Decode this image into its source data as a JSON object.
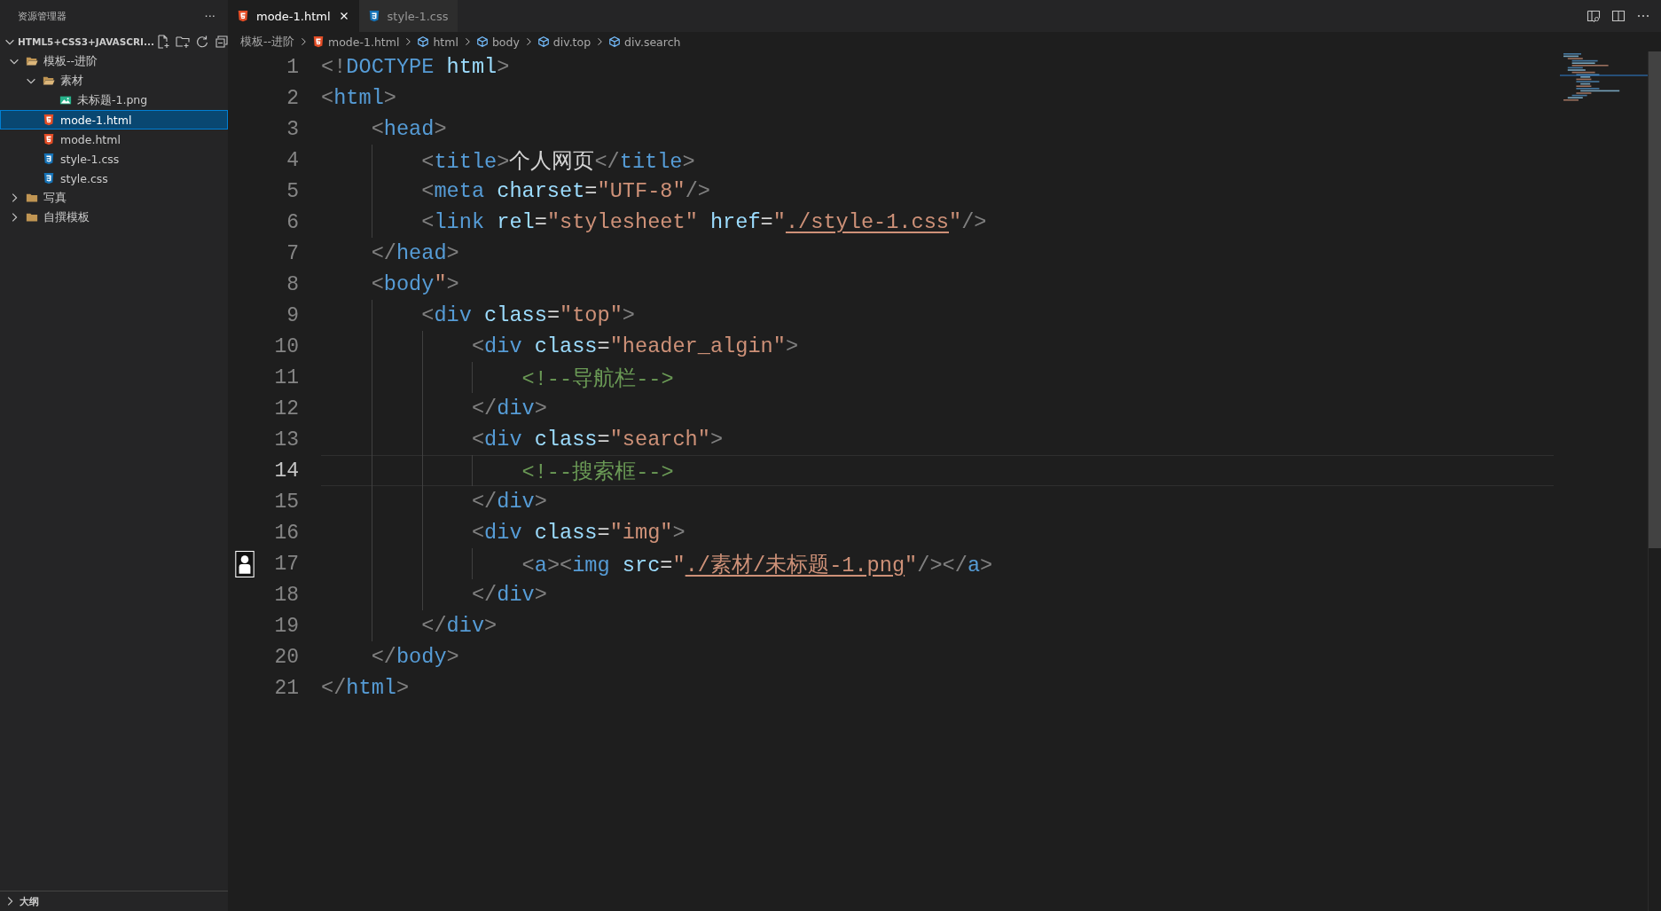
{
  "sidebar": {
    "title": "资源管理器",
    "more": "···",
    "workspace": {
      "name": "HTML5+CSS3+JAVASCRI...",
      "expanded": true
    },
    "tree": [
      {
        "label": "模板--进阶",
        "kind": "folder",
        "expanded": true,
        "selected": false,
        "children": [
          {
            "label": "素材",
            "kind": "folder",
            "expanded": true,
            "selected": false,
            "children": [
              {
                "label": "未标题-1.png",
                "kind": "image",
                "selected": false
              }
            ]
          },
          {
            "label": "mode-1.html",
            "kind": "html",
            "selected": true
          },
          {
            "label": "mode.html",
            "kind": "html",
            "selected": false
          },
          {
            "label": "style-1.css",
            "kind": "css",
            "selected": false
          },
          {
            "label": "style.css",
            "kind": "css",
            "selected": false
          }
        ]
      },
      {
        "label": "写真",
        "kind": "folder",
        "expanded": false,
        "selected": false
      },
      {
        "label": "自撰模板",
        "kind": "folder",
        "expanded": false,
        "selected": false
      }
    ],
    "outline": {
      "label": "大纲",
      "expanded": false
    }
  },
  "tabs": [
    {
      "label": "mode-1.html",
      "kind": "html",
      "selected": true
    },
    {
      "label": "style-1.css",
      "kind": "css",
      "selected": false
    }
  ],
  "breadcrumb": [
    {
      "label": "模板--进阶",
      "kind": "folder"
    },
    {
      "label": "mode-1.html",
      "kind": "html"
    },
    {
      "label": "html",
      "kind": "element"
    },
    {
      "label": "body",
      "kind": "element"
    },
    {
      "label": "div.top",
      "kind": "element"
    },
    {
      "label": "div.search",
      "kind": "element"
    }
  ],
  "editor": {
    "lines": [
      {
        "number": "1",
        "current": false,
        "gutter_icon": false,
        "tokens": [
          {
            "kind": "bracket",
            "text": "<!"
          },
          {
            "kind": "tag",
            "text": "DOCTYPE"
          },
          {
            "kind": "attr",
            "text": " html"
          },
          {
            "kind": "bracket",
            "text": ">"
          }
        ]
      },
      {
        "number": "2",
        "current": false,
        "gutter_icon": false,
        "tokens": [
          {
            "kind": "bracket",
            "text": "<"
          },
          {
            "kind": "tag",
            "text": "html"
          },
          {
            "kind": "bracket",
            "text": ">"
          }
        ]
      },
      {
        "number": "3",
        "current": false,
        "gutter_icon": false,
        "tokens": [
          {
            "kind": "bracket",
            "text": "    <"
          },
          {
            "kind": "tag",
            "text": "head"
          },
          {
            "kind": "bracket",
            "text": ">"
          }
        ]
      },
      {
        "number": "4",
        "current": false,
        "gutter_icon": false,
        "tokens": [
          {
            "kind": "bracket",
            "text": "        <"
          },
          {
            "kind": "tag",
            "text": "title"
          },
          {
            "kind": "bracket",
            "text": ">"
          },
          {
            "kind": "text",
            "text": "个人网页"
          },
          {
            "kind": "bracket",
            "text": "</"
          },
          {
            "kind": "tag",
            "text": "title"
          },
          {
            "kind": "bracket",
            "text": ">"
          }
        ]
      },
      {
        "number": "5",
        "current": false,
        "gutter_icon": false,
        "tokens": [
          {
            "kind": "bracket",
            "text": "        <"
          },
          {
            "kind": "tag",
            "text": "meta"
          },
          {
            "kind": "attr",
            "text": " charset"
          },
          {
            "kind": "text",
            "text": "="
          },
          {
            "kind": "string",
            "text": "\"UTF-8\""
          },
          {
            "kind": "bracket",
            "text": "/>"
          }
        ]
      },
      {
        "number": "6",
        "current": false,
        "gutter_icon": false,
        "tokens": [
          {
            "kind": "bracket",
            "text": "        <"
          },
          {
            "kind": "tag",
            "text": "link"
          },
          {
            "kind": "attr",
            "text": " rel"
          },
          {
            "kind": "text",
            "text": "="
          },
          {
            "kind": "string",
            "text": "\"stylesheet\""
          },
          {
            "kind": "attr",
            "text": " href"
          },
          {
            "kind": "text",
            "text": "="
          },
          {
            "kind": "string",
            "text": "\""
          },
          {
            "kind": "link",
            "text": "./style-1.css"
          },
          {
            "kind": "string",
            "text": "\""
          },
          {
            "kind": "bracket",
            "text": "/>"
          }
        ]
      },
      {
        "number": "7",
        "current": false,
        "gutter_icon": false,
        "tokens": [
          {
            "kind": "bracket",
            "text": "    </"
          },
          {
            "kind": "tag",
            "text": "head"
          },
          {
            "kind": "bracket",
            "text": ">"
          }
        ]
      },
      {
        "number": "8",
        "current": false,
        "gutter_icon": false,
        "tokens": [
          {
            "kind": "bracket",
            "text": "    <"
          },
          {
            "kind": "tag",
            "text": "body"
          },
          {
            "kind": "string",
            "text": "\""
          },
          {
            "kind": "bracket",
            "text": ">"
          }
        ]
      },
      {
        "number": "9",
        "current": false,
        "gutter_icon": false,
        "tokens": [
          {
            "kind": "bracket",
            "text": "        <"
          },
          {
            "kind": "tag",
            "text": "div"
          },
          {
            "kind": "attr",
            "text": " class"
          },
          {
            "kind": "text",
            "text": "="
          },
          {
            "kind": "string",
            "text": "\"top\""
          },
          {
            "kind": "bracket",
            "text": ">"
          }
        ]
      },
      {
        "number": "10",
        "current": false,
        "gutter_icon": false,
        "tokens": [
          {
            "kind": "bracket",
            "text": "            <"
          },
          {
            "kind": "tag",
            "text": "div"
          },
          {
            "kind": "attr",
            "text": " class"
          },
          {
            "kind": "text",
            "text": "="
          },
          {
            "kind": "string",
            "text": "\"header_algin\""
          },
          {
            "kind": "bracket",
            "text": ">"
          }
        ]
      },
      {
        "number": "11",
        "current": false,
        "gutter_icon": false,
        "tokens": [
          {
            "kind": "comment",
            "text": "                <!--导航栏-->"
          }
        ]
      },
      {
        "number": "12",
        "current": false,
        "gutter_icon": false,
        "tokens": [
          {
            "kind": "bracket",
            "text": "            </"
          },
          {
            "kind": "tag",
            "text": "div"
          },
          {
            "kind": "bracket",
            "text": ">"
          }
        ]
      },
      {
        "number": "13",
        "current": false,
        "gutter_icon": false,
        "tokens": [
          {
            "kind": "bracket",
            "text": "            <"
          },
          {
            "kind": "tag",
            "text": "div"
          },
          {
            "kind": "attr",
            "text": " class"
          },
          {
            "kind": "text",
            "text": "="
          },
          {
            "kind": "string",
            "text": "\"search\""
          },
          {
            "kind": "bracket",
            "text": ">"
          }
        ]
      },
      {
        "number": "14",
        "current": true,
        "gutter_icon": false,
        "tokens": [
          {
            "kind": "comment",
            "text": "                <!--搜索框-->"
          }
        ]
      },
      {
        "number": "15",
        "current": false,
        "gutter_icon": false,
        "tokens": [
          {
            "kind": "bracket",
            "text": "            </"
          },
          {
            "kind": "tag",
            "text": "div"
          },
          {
            "kind": "bracket",
            "text": ">"
          }
        ]
      },
      {
        "number": "16",
        "current": false,
        "gutter_icon": false,
        "tokens": [
          {
            "kind": "bracket",
            "text": "            <"
          },
          {
            "kind": "tag",
            "text": "div"
          },
          {
            "kind": "attr",
            "text": " class"
          },
          {
            "kind": "text",
            "text": "="
          },
          {
            "kind": "string",
            "text": "\"img\""
          },
          {
            "kind": "bracket",
            "text": ">"
          }
        ]
      },
      {
        "number": "17",
        "current": false,
        "gutter_icon": true,
        "tokens": [
          {
            "kind": "bracket",
            "text": "                <"
          },
          {
            "kind": "tag",
            "text": "a"
          },
          {
            "kind": "bracket",
            "text": "><"
          },
          {
            "kind": "tag",
            "text": "img"
          },
          {
            "kind": "attr",
            "text": " src"
          },
          {
            "kind": "text",
            "text": "="
          },
          {
            "kind": "string",
            "text": "\""
          },
          {
            "kind": "link",
            "text": "./素材/未标题-1.png"
          },
          {
            "kind": "string",
            "text": "\""
          },
          {
            "kind": "bracket",
            "text": "/></"
          },
          {
            "kind": "tag",
            "text": "a"
          },
          {
            "kind": "bracket",
            "text": ">"
          }
        ]
      },
      {
        "number": "18",
        "current": false,
        "gutter_icon": false,
        "tokens": [
          {
            "kind": "bracket",
            "text": "            </"
          },
          {
            "kind": "tag",
            "text": "div"
          },
          {
            "kind": "bracket",
            "text": ">"
          }
        ]
      },
      {
        "number": "19",
        "current": false,
        "gutter_icon": false,
        "tokens": [
          {
            "kind": "bracket",
            "text": "        </"
          },
          {
            "kind": "tag",
            "text": "div"
          },
          {
            "kind": "bracket",
            "text": ">"
          }
        ]
      },
      {
        "number": "20",
        "current": false,
        "gutter_icon": false,
        "tokens": [
          {
            "kind": "bracket",
            "text": "    </"
          },
          {
            "kind": "tag",
            "text": "body"
          },
          {
            "kind": "bracket",
            "text": ">"
          }
        ]
      },
      {
        "number": "21",
        "current": false,
        "gutter_icon": false,
        "tokens": [
          {
            "kind": "bracket",
            "text": "</"
          },
          {
            "kind": "tag",
            "text": "html"
          },
          {
            "kind": "bracket",
            "text": ">"
          }
        ]
      }
    ]
  }
}
